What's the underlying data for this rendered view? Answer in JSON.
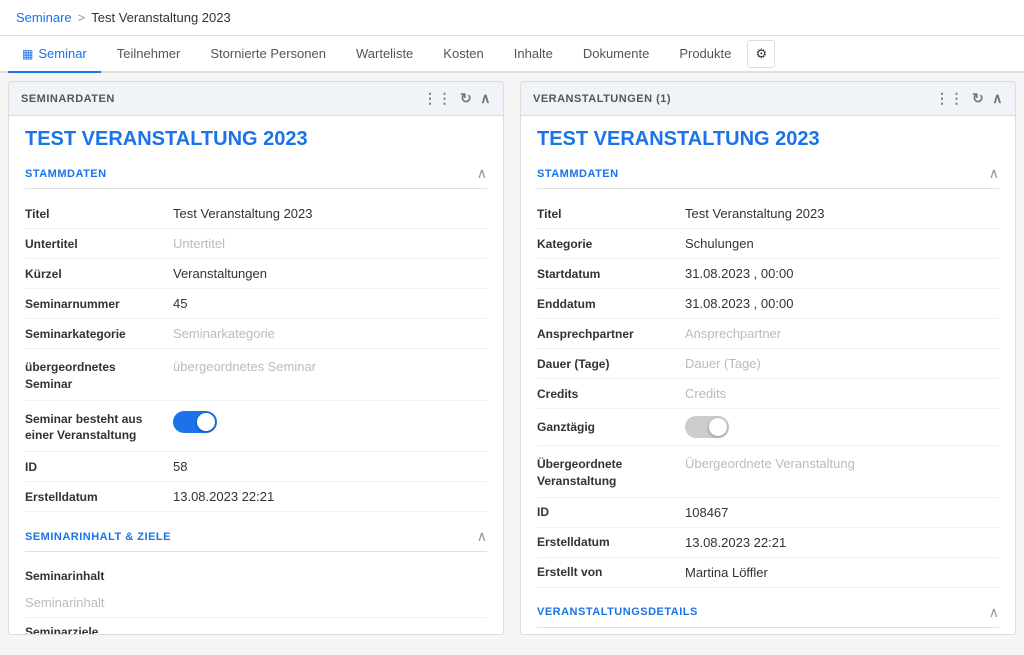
{
  "breadcrumb": {
    "link_label": "Seminare",
    "separator": ">",
    "current": "Test Veranstaltung 2023"
  },
  "tabs": [
    {
      "id": "seminar",
      "label": "Seminar",
      "active": true,
      "icon": "grid"
    },
    {
      "id": "teilnehmer",
      "label": "Teilnehmer",
      "active": false
    },
    {
      "id": "stornierte",
      "label": "Stornierte Personen",
      "active": false
    },
    {
      "id": "warteliste",
      "label": "Warteliste",
      "active": false
    },
    {
      "id": "kosten",
      "label": "Kosten",
      "active": false
    },
    {
      "id": "inhalte",
      "label": "Inhalte",
      "active": false
    },
    {
      "id": "dokumente",
      "label": "Dokumente",
      "active": false
    },
    {
      "id": "produkte",
      "label": "Produkte",
      "active": false
    }
  ],
  "left_panel": {
    "header": "SEMINARDATEN",
    "title": "TEST VERANSTALTUNG 2023",
    "stammdaten": {
      "section_title": "STAMMDATEN",
      "fields": [
        {
          "label": "Titel",
          "value": "Test Veranstaltung 2023",
          "placeholder": false
        },
        {
          "label": "Untertitel",
          "value": "Untertitel",
          "placeholder": true
        },
        {
          "label": "Kürzel",
          "value": "Veranstaltungen",
          "placeholder": false
        },
        {
          "label": "Seminarnummer",
          "value": "45",
          "placeholder": false
        },
        {
          "label": "Seminarkategorie",
          "value": "Seminarkategorie",
          "placeholder": true
        }
      ],
      "ubergeordnetes": {
        "label": "übergeordnetes Seminar",
        "value": "übergeordnetes Seminar",
        "placeholder": true
      },
      "toggle_field": {
        "label": "Seminar besteht aus einer Veranstaltung",
        "value": true
      },
      "id_field": {
        "label": "ID",
        "value": "58"
      },
      "erstelldatum": {
        "label": "Erstelldatum",
        "value": "13.08.2023 22:21"
      }
    },
    "seminarinhalt": {
      "section_title": "SEMINARINHALT & ZIELE",
      "fields": [
        {
          "label": "Seminarinhalt",
          "value": "Seminarinhalt",
          "placeholder": true
        },
        {
          "label": "Seminarziele",
          "value": "",
          "placeholder": false
        }
      ]
    }
  },
  "right_panel": {
    "header": "VERANSTALTUNGEN (1)",
    "title": "TEST VERANSTALTUNG 2023",
    "stammdaten": {
      "section_title": "STAMMDATEN",
      "fields": [
        {
          "label": "Titel",
          "value": "Test Veranstaltung 2023",
          "placeholder": false
        },
        {
          "label": "Kategorie",
          "value": "Schulungen",
          "placeholder": false
        },
        {
          "label": "Startdatum",
          "value": "31.08.2023 ,  00:00",
          "placeholder": false
        },
        {
          "label": "Enddatum",
          "value": "31.08.2023 ,  00:00",
          "placeholder": false
        },
        {
          "label": "Ansprechpartner",
          "value": "Ansprechpartner",
          "placeholder": true
        },
        {
          "label": "Dauer (Tage)",
          "value": "Dauer (Tage)",
          "placeholder": true
        },
        {
          "label": "Credits",
          "value": "Credits",
          "placeholder": true
        }
      ],
      "ganztaegig": {
        "label": "Ganztägig",
        "value": false
      },
      "ubergeordnete": {
        "label": "Übergeordnete Veranstaltung",
        "value": "Übergeordnete Veranstaltung",
        "placeholder": true
      },
      "id_field": {
        "label": "ID",
        "value": "108467"
      },
      "erstelldatum": {
        "label": "Erstelldatum",
        "value": "13.08.2023 22:21"
      },
      "erstellt_von": {
        "label": "Erstellt von",
        "value": "Martina Löffler"
      }
    },
    "veranstaltungsdetails": {
      "section_title": "VERANSTALTUNGSDETAILS"
    }
  },
  "icons": {
    "grid": "▦",
    "dots": "⋮⋮",
    "refresh": "↻",
    "collapse": "∧",
    "gear": "⚙"
  }
}
